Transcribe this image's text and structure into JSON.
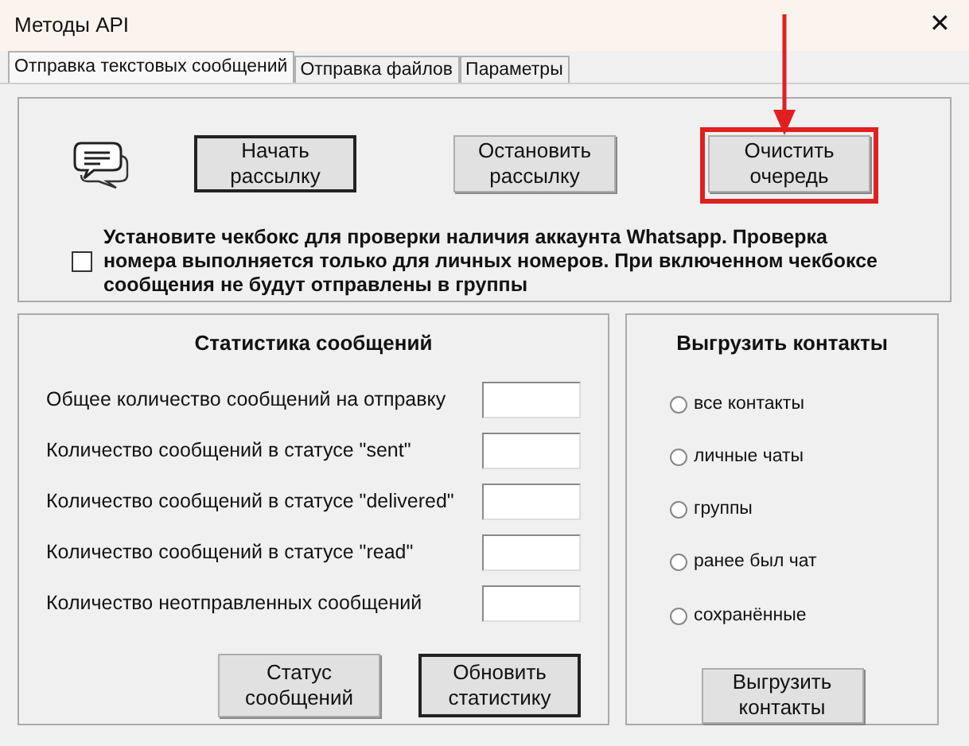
{
  "window": {
    "title": "Методы API",
    "close": "✕"
  },
  "tabs": [
    {
      "label": "Отправка текстовых сообщений",
      "selected": true
    },
    {
      "label": "Отправка файлов",
      "selected": false
    },
    {
      "label": "Параметры",
      "selected": false
    }
  ],
  "top_buttons": [
    {
      "label": "Начать рассылку",
      "default": true,
      "highlighted": false
    },
    {
      "label": "Остановить рассылку",
      "default": false,
      "highlighted": false
    },
    {
      "label": "Очистить очередь",
      "default": false,
      "highlighted": true
    }
  ],
  "check": {
    "label": "Установите чекбокс для проверки наличия аккаунта Whatsapp. Проверка номера выполняется только для личных номеров. При включенном чекбоксе сообщения не будут отправлены в группы",
    "checked": false
  },
  "stats": {
    "title": "Статистика сообщений",
    "rows": [
      {
        "label": "Общее количество сообщений на отправку"
      },
      {
        "label": "Количество сообщений в статусе \"sent\""
      },
      {
        "label": "Количество сообщений в статусе \"delivered\""
      },
      {
        "label": "Количество сообщений в статусе \"read\""
      },
      {
        "label": "Количество неотправленных сообщений"
      }
    ],
    "buttons": [
      {
        "label": "Статус сообщений",
        "default": false
      },
      {
        "label": "Обновить статистику",
        "default": true
      }
    ]
  },
  "export": {
    "title": "Выгрузить контакты",
    "options": [
      {
        "label": "все контакты",
        "selected": false
      },
      {
        "label": "личные чаты",
        "selected": false
      },
      {
        "label": "группы",
        "selected": false
      },
      {
        "label": "ранее был чат",
        "selected": false
      },
      {
        "label": "сохранённые",
        "selected": false
      }
    ],
    "button": {
      "label": "Выгрузить контакты",
      "default": false
    }
  }
}
